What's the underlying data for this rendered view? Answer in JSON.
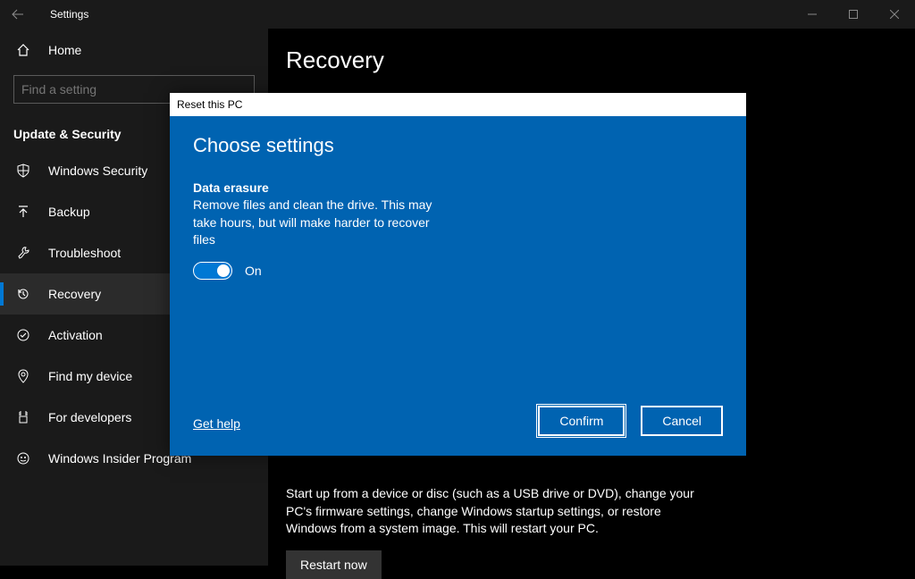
{
  "titlebar": {
    "title": "Settings"
  },
  "sidebar": {
    "home": "Home",
    "search_placeholder": "Find a setting",
    "section": "Update & Security",
    "items": [
      {
        "label": "Windows Security",
        "icon": "shield"
      },
      {
        "label": "Backup",
        "icon": "backup"
      },
      {
        "label": "Troubleshoot",
        "icon": "wrench"
      },
      {
        "label": "Recovery",
        "icon": "recovery",
        "selected": true
      },
      {
        "label": "Activation",
        "icon": "check-circle"
      },
      {
        "label": "Find my device",
        "icon": "location"
      },
      {
        "label": "For developers",
        "icon": "dev"
      },
      {
        "label": "Windows Insider Program",
        "icon": "insider"
      }
    ]
  },
  "main": {
    "title": "Recovery",
    "startup_text": "Start up from a device or disc (such as a USB drive or DVD), change your PC's firmware settings, change Windows startup settings, or restore Windows from a system image. This will restart your PC.",
    "restart_btn": "Restart now"
  },
  "dialog": {
    "titlebar": "Reset this PC",
    "heading": "Choose settings",
    "setting_title": "Data erasure",
    "setting_desc": "Remove files and clean the drive. This may take hours, but will make harder to recover files",
    "toggle_state": "On",
    "help_link": "Get help",
    "confirm": "Confirm",
    "cancel": "Cancel"
  }
}
